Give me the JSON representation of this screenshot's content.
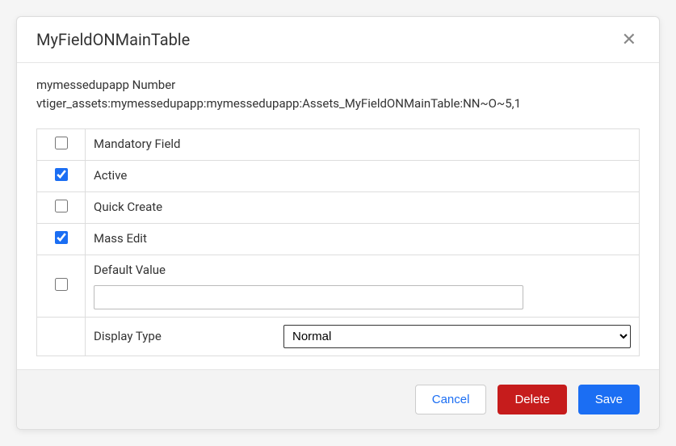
{
  "modal": {
    "title": "MyFieldONMainTable",
    "info_line1": "mymessedupapp Number",
    "info_line2": "vtiger_assets:mymessedupapp:mymessedupapp:Assets_MyFieldONMainTable:NN~O~5,1"
  },
  "options": {
    "mandatory": {
      "label": "Mandatory Field",
      "checked": false
    },
    "active": {
      "label": "Active",
      "checked": true
    },
    "quick_create": {
      "label": "Quick Create",
      "checked": false
    },
    "mass_edit": {
      "label": "Mass Edit",
      "checked": true
    },
    "default_value": {
      "label": "Default Value",
      "checked": false,
      "value": ""
    },
    "display_type": {
      "label": "Display Type",
      "selected": "Normal"
    }
  },
  "buttons": {
    "cancel": "Cancel",
    "delete": "Delete",
    "save": "Save"
  }
}
